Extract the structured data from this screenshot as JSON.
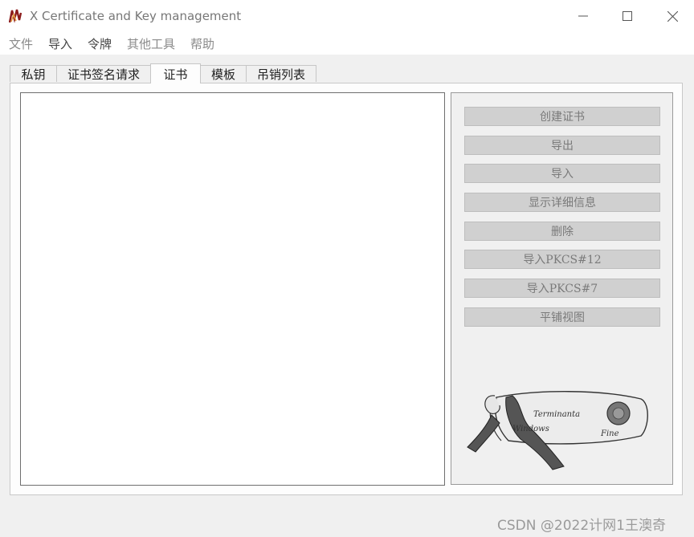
{
  "window": {
    "title": "X Certificate and Key management",
    "controls": {
      "minimize": "minimize-icon",
      "maximize": "maximize-icon",
      "close": "close-icon"
    }
  },
  "menu": {
    "items": [
      {
        "label": "文件"
      },
      {
        "label": "导入"
      },
      {
        "label": "令牌"
      },
      {
        "label": "其他工具"
      },
      {
        "label": "帮助"
      }
    ]
  },
  "tabs": {
    "items": [
      {
        "label": "私钥"
      },
      {
        "label": "证书签名请求"
      },
      {
        "label": "证书"
      },
      {
        "label": "模板"
      },
      {
        "label": "吊销列表"
      }
    ],
    "active": "证书"
  },
  "actions": {
    "buttons": [
      {
        "label": "创建证书"
      },
      {
        "label": "导出"
      },
      {
        "label": "导入"
      },
      {
        "label": "显示详细信息"
      },
      {
        "label": "删除"
      },
      {
        "label": "导入PKCS#12"
      },
      {
        "label": "导入PKCS#7"
      },
      {
        "label": "平铺视图"
      }
    ]
  },
  "logo": {
    "icon": "certificate-scroll-icon",
    "text_line1": "Terminanta",
    "text_line2": "Windows",
    "text_line3": "Fine"
  },
  "watermark": "CSDN @2022计网1王澳奇",
  "colors": {
    "button_bg": "#d0d0d0",
    "button_text": "#7a7a7a",
    "list_border": "#6e6e6e"
  }
}
